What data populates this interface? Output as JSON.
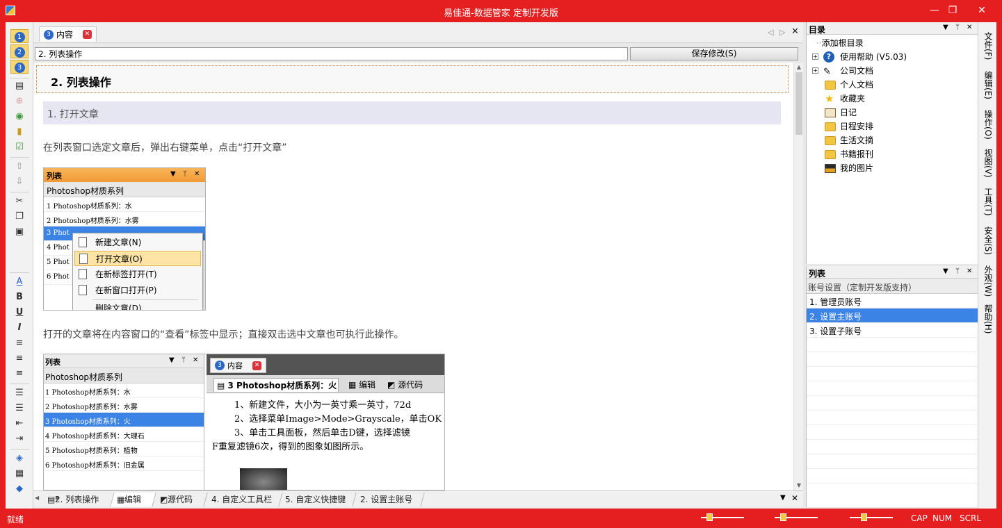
{
  "window": {
    "title": "易佳通-数据管家 定制开发版",
    "minimize": "—",
    "restore": "❐",
    "close": "✕"
  },
  "left_toolbar": {
    "num1": "1",
    "num2": "2",
    "num3": "3",
    "font_color": "A",
    "bold": "B",
    "underline": "U",
    "italic": "I"
  },
  "doc_tab": {
    "num": "3",
    "label": "内容",
    "close": "✕"
  },
  "title_input_value": "2. 列表操作",
  "save_button": "保存修改(S)",
  "content": {
    "heading1": "2. 列表操作",
    "heading2": "1.   打开文章",
    "para1": "在列表窗口选定文章后，弹出右键菜单，点击“打开文章”",
    "para2": "打开的文章将在内容窗口的“查看”标签中显示；直接双击选中文章也可执行此操作。",
    "shot1": {
      "title": "列表",
      "subheader": "Photoshop材质系列",
      "rows": [
        "1 Photoshop材质系列：水",
        "2 Photoshop材质系列：水雾",
        "3 Phot",
        "4 Phot",
        "5 Phot",
        "6 Phot"
      ],
      "menu": [
        "新建文章(N)",
        "打开文章(O)",
        "在新标签打开(T)",
        "在新窗口打开(P)",
        "删除文章(D)"
      ]
    },
    "shot2": {
      "title": "列表",
      "subheader": "Photoshop材质系列",
      "rows": [
        "1 Photoshop材质系列：水",
        "2 Photoshop材质系列：水雾",
        "3 Photoshop材质系列：火",
        "4 Photoshop材质系列：大理石",
        "5 Photoshop材质系列：植物",
        "6 Photoshop材质系列：旧金属"
      ],
      "view_tab_num": "3",
      "view_tab_label": "内容",
      "subtab_active": "3 Photoshop材质系列：火",
      "subtab_edit": "编辑",
      "subtab_source": "源代码",
      "lines": [
        "1、新建文件，大小为一英寸乘一英寸，72d",
        "2、选择菜单Image>Mode>Grayscale，单击OK",
        "3、单击工具面板，然后单击D键，选择滤镜",
        "F重复滤镜6次，得到的图象如图所示。"
      ]
    }
  },
  "bottom_tabs": [
    "2. 列表操作",
    "编辑",
    "源代码",
    "4. 自定义工具栏",
    "5. 自定义快捷键",
    "2. 设置主账号"
  ],
  "toc": {
    "title": "目录",
    "items": [
      "添加根目录",
      "使用帮助 (V5.03)",
      "公司文档",
      "个人文档",
      "收藏夹",
      "日记",
      "日程安排",
      "生活文摘",
      "书籍报刊",
      "我的图片"
    ]
  },
  "list_panel": {
    "title": "列表",
    "subheader": "账号设置（定制开发版支持）",
    "rows": [
      "1.  管理员账号",
      "2.  设置主账号",
      "3.  设置子账号"
    ]
  },
  "right_menu": [
    "文件(F)",
    "编辑(E)",
    "操作(O)",
    "视图(V)",
    "工具(T)",
    "安全(S)",
    "外观(W)",
    "帮助(H)"
  ],
  "status": {
    "text": "就绪",
    "cap": "CAP",
    "num": "NUM",
    "scrl": "SCRL"
  },
  "colors": {
    "frame": "#e51f1f",
    "selection": "#3b83e5",
    "accent": "#f7d774"
  }
}
